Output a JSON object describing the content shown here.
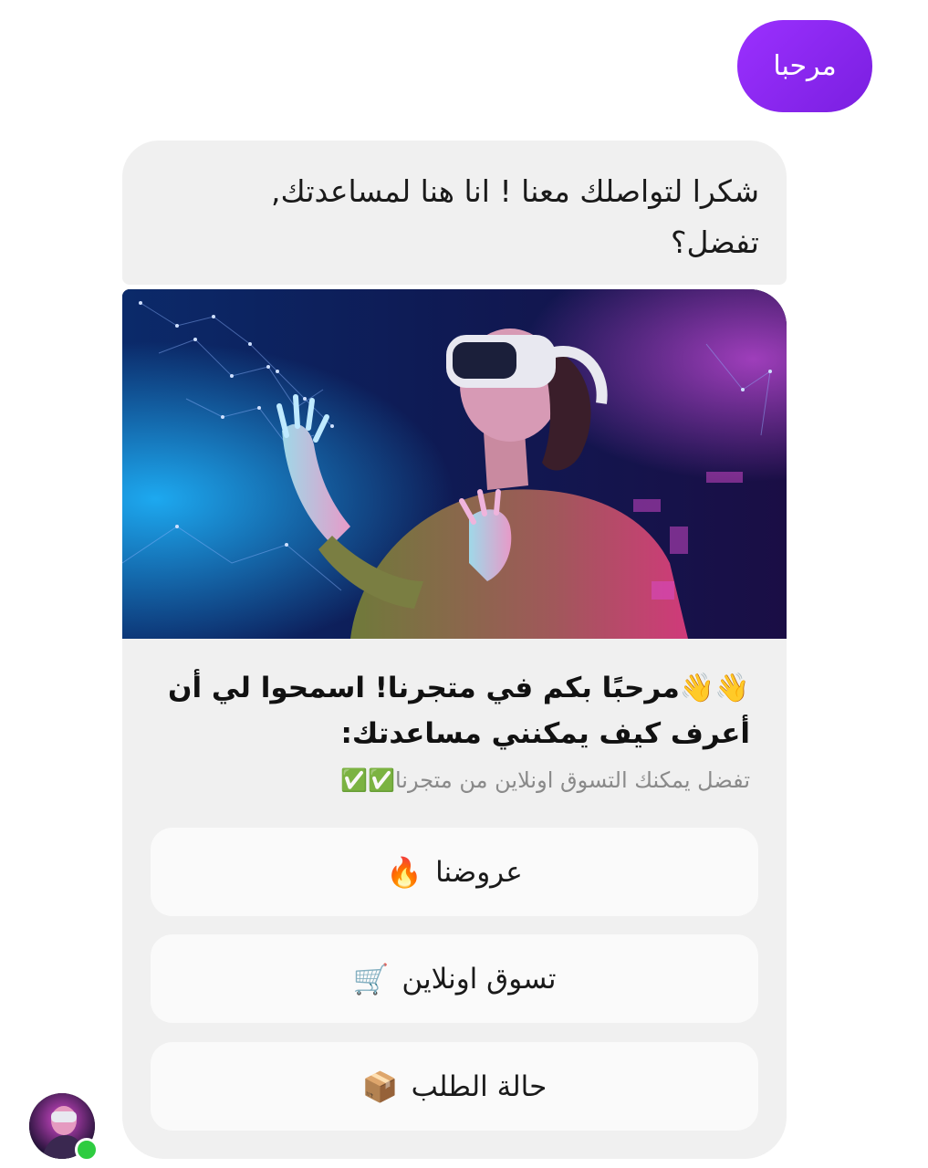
{
  "user_message": {
    "text": "مرحبا"
  },
  "bot_message": {
    "line1": "شكرا لتواصلك معنا ! انا هنا لمساعدتك,",
    "line2": "تفضل؟"
  },
  "card": {
    "image_subject": "person wearing VR headset with digital network graphics",
    "title_line1": "👋👋مرحبًا بكم في متجرنا! اسمحوا لي أن",
    "title_line2": "أعرف كيف يمكنني مساعدتك:",
    "subtitle": "تفضل يمكنك التسوق اونلاين من متجرنا✅✅",
    "buttons": [
      {
        "label": "عروضنا",
        "emoji": "🔥"
      },
      {
        "label": "تسوق اونلاين",
        "emoji": "🛒"
      },
      {
        "label": "حالة الطلب",
        "emoji": "📦"
      }
    ]
  },
  "avatar": {
    "status": "online"
  },
  "colors": {
    "user_bubble": "#8a2be2",
    "bubble_bg": "#f0f0f0",
    "online": "#2ecc40"
  }
}
